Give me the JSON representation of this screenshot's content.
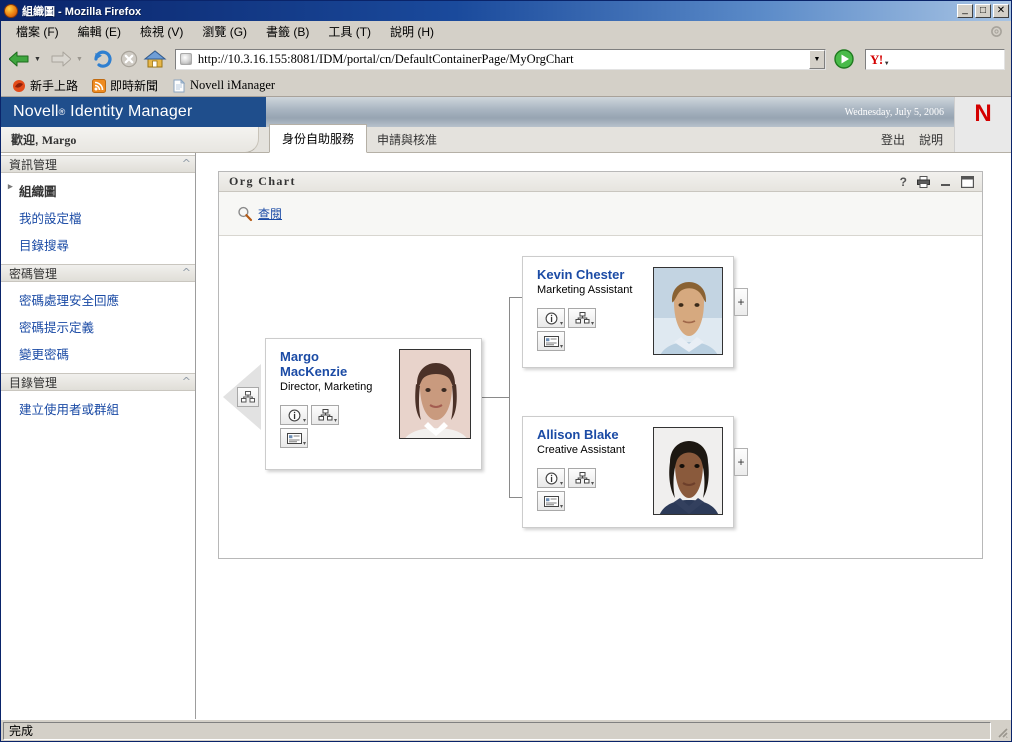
{
  "window": {
    "title": "組織圖 - Mozilla Firefox",
    "minimize_label": "_",
    "maximize_label": "□",
    "close_label": "✕"
  },
  "menu": {
    "items": [
      {
        "label": "檔案 (F)"
      },
      {
        "label": "編輯 (E)"
      },
      {
        "label": "檢視 (V)"
      },
      {
        "label": "瀏覽 (G)"
      },
      {
        "label": "書籤 (B)"
      },
      {
        "label": "工具 (T)"
      },
      {
        "label": "說明 (H)"
      }
    ]
  },
  "toolbar": {
    "back_icon": "back-arrow-icon",
    "forward_icon": "forward-arrow-icon",
    "reload_icon": "reload-icon",
    "stop_icon": "stop-icon",
    "home_icon": "home-icon",
    "url": "http://10.3.16.155:8081/IDM/portal/cn/DefaultContainerPage/MyOrgChart",
    "go_icon": "go-icon",
    "search_engine": "Y!",
    "search_value": ""
  },
  "bookmarks": [
    {
      "label": "新手上路",
      "icon": "firefox-icon"
    },
    {
      "label": "即時新聞",
      "icon": "rss-icon"
    },
    {
      "label": "Novell iManager",
      "icon": "page-icon"
    }
  ],
  "app_header": {
    "brand": "Novell",
    "brand_reg": "®",
    "brand_product": "Identity Manager",
    "date": "Wednesday, July 5, 2006",
    "logo": "N",
    "welcome_prefix": "歡迎,",
    "welcome_user": "Margo",
    "tabs": [
      {
        "label": "身份自助服務",
        "active": true
      },
      {
        "label": "申請與核准",
        "active": false
      }
    ],
    "links": [
      {
        "label": "登出"
      },
      {
        "label": "說明"
      }
    ]
  },
  "sidebar": {
    "groups": [
      {
        "title": "資訊管理",
        "items": [
          {
            "label": "組織圖",
            "selected": true
          },
          {
            "label": "我的設定檔",
            "selected": false
          },
          {
            "label": "目錄搜尋",
            "selected": false
          }
        ]
      },
      {
        "title": "密碼管理",
        "items": [
          {
            "label": "密碼處理安全回應",
            "selected": false
          },
          {
            "label": "密碼提示定義",
            "selected": false
          },
          {
            "label": "變更密碼",
            "selected": false
          }
        ]
      },
      {
        "title": "目錄管理",
        "items": [
          {
            "label": "建立使用者或群組",
            "selected": false
          }
        ]
      }
    ]
  },
  "portlet": {
    "title": "Org Chart",
    "icons": [
      {
        "name": "help-icon",
        "glyph": "?"
      },
      {
        "name": "print-icon",
        "glyph": "printer"
      },
      {
        "name": "minimize-icon",
        "glyph": "_"
      },
      {
        "name": "maximize-icon",
        "glyph": "□"
      }
    ],
    "lookup_label": "查閱",
    "lookup_icon": "magnifier-icon"
  },
  "org_chart": {
    "root": {
      "name": "Margo MacKenzie",
      "name_line1": "Margo",
      "name_line2": "MacKenzie",
      "title": "Director, Marketing",
      "photo_alt": "Margo MacKenzie photo",
      "actions": [
        {
          "name": "info-action",
          "icon": "info-icon"
        },
        {
          "name": "orgchart-action",
          "icon": "orgchart-icon"
        },
        {
          "name": "email-action",
          "icon": "email-card-icon"
        }
      ],
      "nav_up_icon": "orgchart-icon"
    },
    "children": [
      {
        "name": "Kevin Chester",
        "title": "Marketing Assistant",
        "photo_alt": "Kevin Chester photo",
        "expand_label": "+",
        "actions": [
          {
            "name": "info-action",
            "icon": "info-icon"
          },
          {
            "name": "orgchart-action",
            "icon": "orgchart-icon"
          },
          {
            "name": "email-action",
            "icon": "email-card-icon"
          }
        ]
      },
      {
        "name": "Allison Blake",
        "title": "Creative Assistant",
        "photo_alt": "Allison Blake photo",
        "expand_label": "+",
        "actions": [
          {
            "name": "info-action",
            "icon": "info-icon"
          },
          {
            "name": "orgchart-action",
            "icon": "orgchart-icon"
          },
          {
            "name": "email-action",
            "icon": "email-card-icon"
          }
        ]
      }
    ]
  },
  "statusbar": {
    "text": "完成"
  },
  "colors": {
    "brand_blue": "#1f4e8c",
    "link_blue": "#1b4ba5",
    "novell_red": "#d40000",
    "titlebar_blue": "#0a246a"
  }
}
